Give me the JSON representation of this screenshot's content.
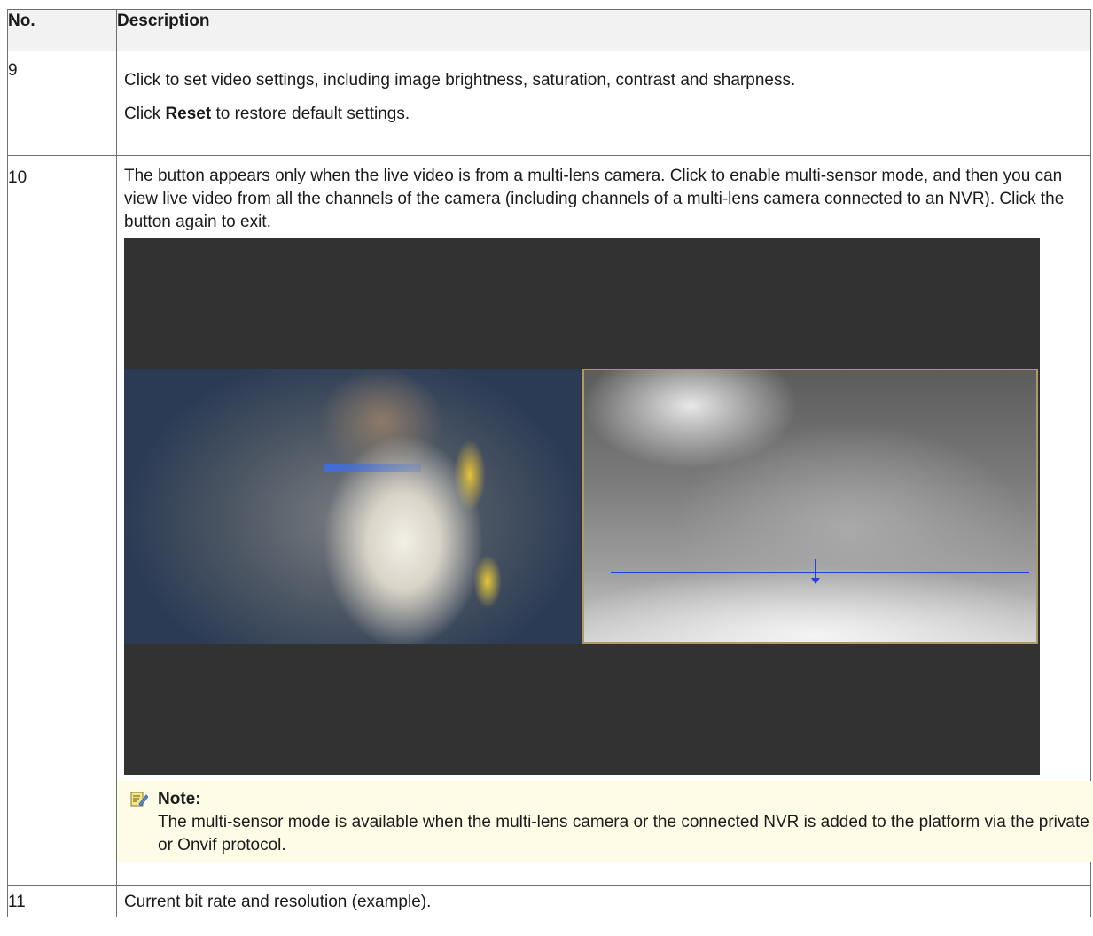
{
  "table": {
    "header": {
      "col_no": "No.",
      "col_desc": "Description"
    },
    "rows": [
      {
        "no": "9",
        "line1": "Click to set video settings, including image brightness, saturation, contrast and sharpness.",
        "line2_pre": "Click ",
        "line2_bold": "Reset",
        "line2_post": " to restore default settings."
      },
      {
        "no": "10",
        "text": "The button appears only when the live video is from a multi-lens camera. Click to enable multi-sensor mode, and then you can view live video from all the channels of the camera (including channels of a multi-lens camera connected to an NVR). Click the button again to exit.",
        "note_title": "Note:",
        "note_body": "The multi-sensor mode is available when the multi-lens camera or the connected NVR is added to the platform via the private or Onvif protocol.",
        "note_icon": "note-pencil-icon"
      },
      {
        "no": "11",
        "text": "Current bit rate and resolution (example)."
      }
    ]
  },
  "colors": {
    "header_bg": "#f2f2f2",
    "note_bg": "#fefbe6",
    "video_bg": "#323232",
    "active_feed_border": "#b39867",
    "line_blue": "#2a3ee6"
  }
}
